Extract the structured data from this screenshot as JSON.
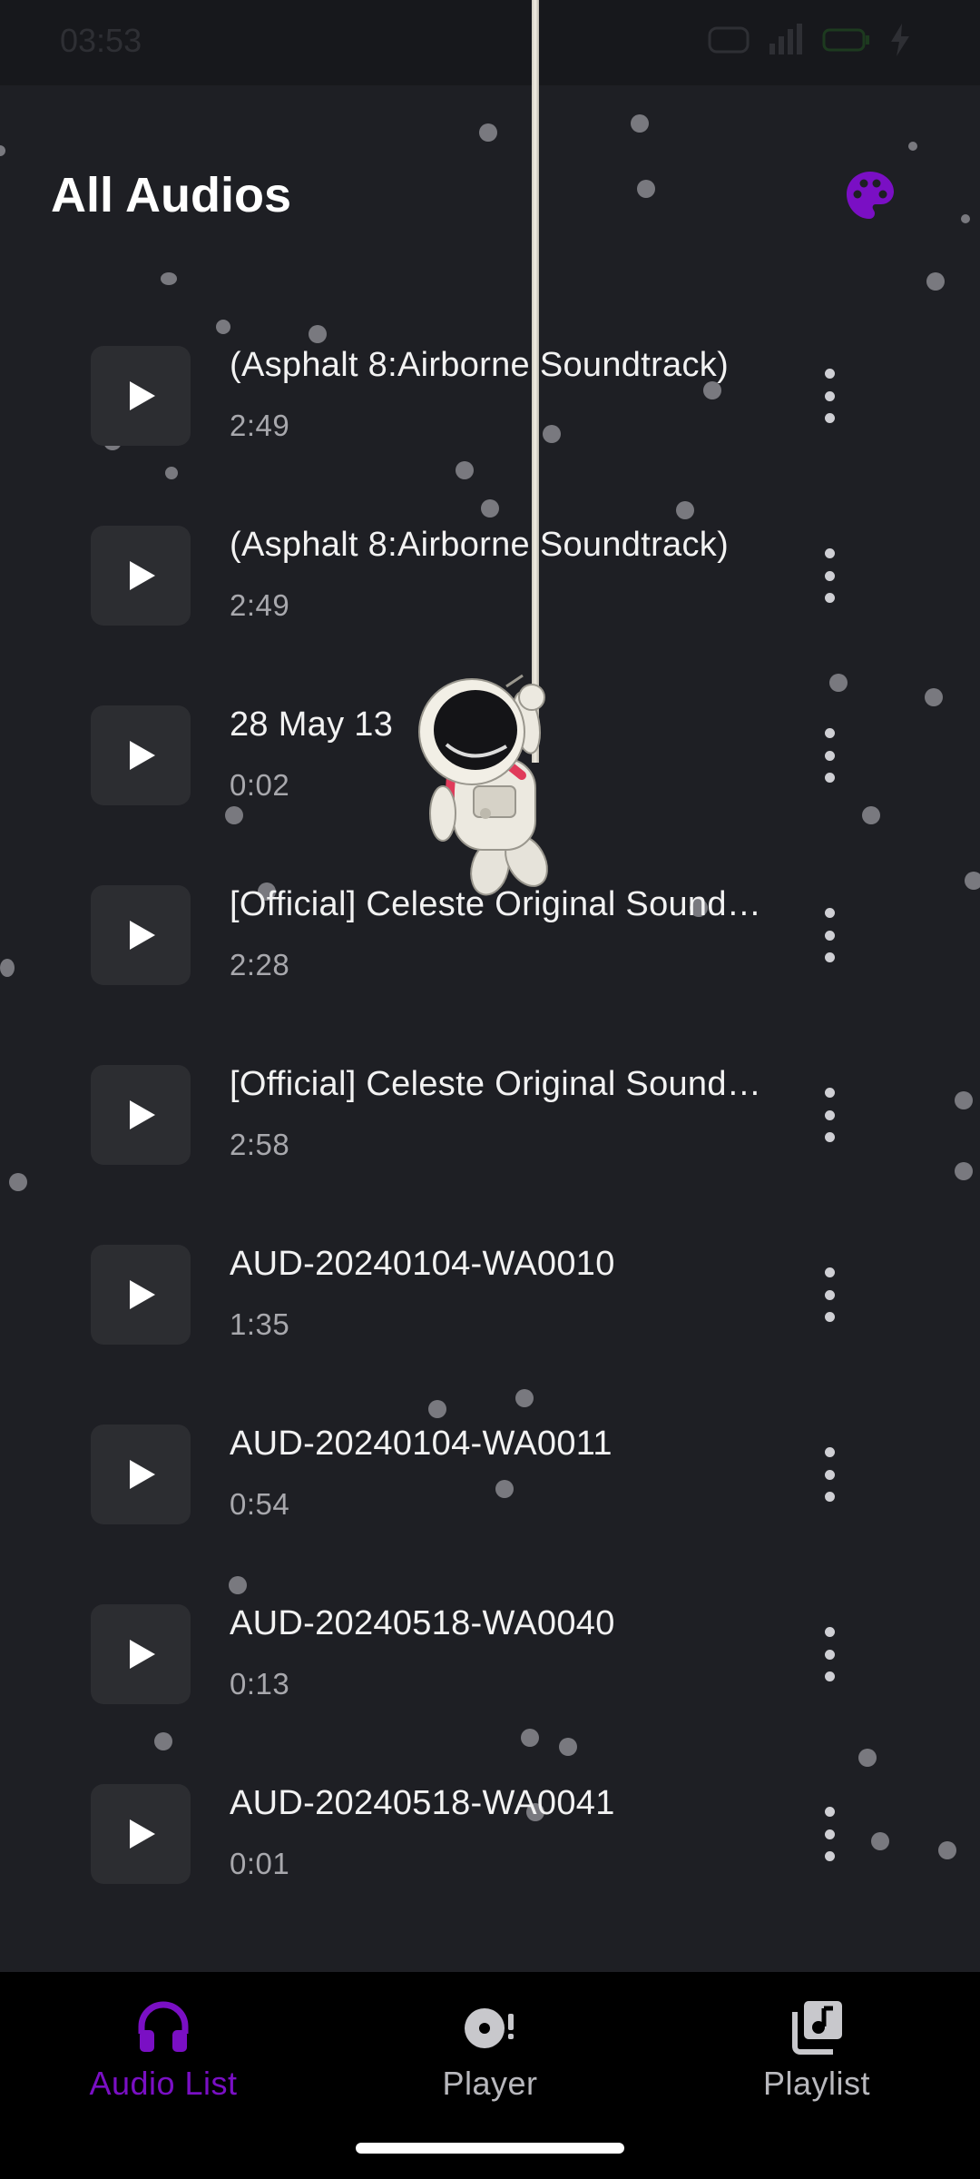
{
  "status_bar": {
    "time": "03:53"
  },
  "header": {
    "title": "All Audios"
  },
  "audios": [
    {
      "title": "(Asphalt 8:Airborne Soundtrack)",
      "duration": "2:49"
    },
    {
      "title": "(Asphalt 8:Airborne Soundtrack)",
      "duration": "2:49"
    },
    {
      "title": "28 May 13",
      "duration": "0:02"
    },
    {
      "title": "[Official] Celeste Original Soundtrack",
      "duration": "2:28"
    },
    {
      "title": "[Official] Celeste Original Soundtrack",
      "duration": "2:58"
    },
    {
      "title": "AUD-20240104-WA0010",
      "duration": "1:35"
    },
    {
      "title": "AUD-20240104-WA0011",
      "duration": "0:54"
    },
    {
      "title": "AUD-20240518-WA0040",
      "duration": "0:13"
    },
    {
      "title": "AUD-20240518-WA0041",
      "duration": "0:01"
    }
  ],
  "bottom_nav": {
    "items": [
      {
        "label": "Audio List",
        "icon": "headphones-icon",
        "active": true
      },
      {
        "label": "Player",
        "icon": "disc-icon",
        "active": false
      },
      {
        "label": "Playlist",
        "icon": "library-music-icon",
        "active": false
      }
    ]
  },
  "colors": {
    "accent": "#7a0fc4",
    "background": "#1e1f24",
    "tile": "#2c2d31",
    "nav_bg": "#000000"
  }
}
